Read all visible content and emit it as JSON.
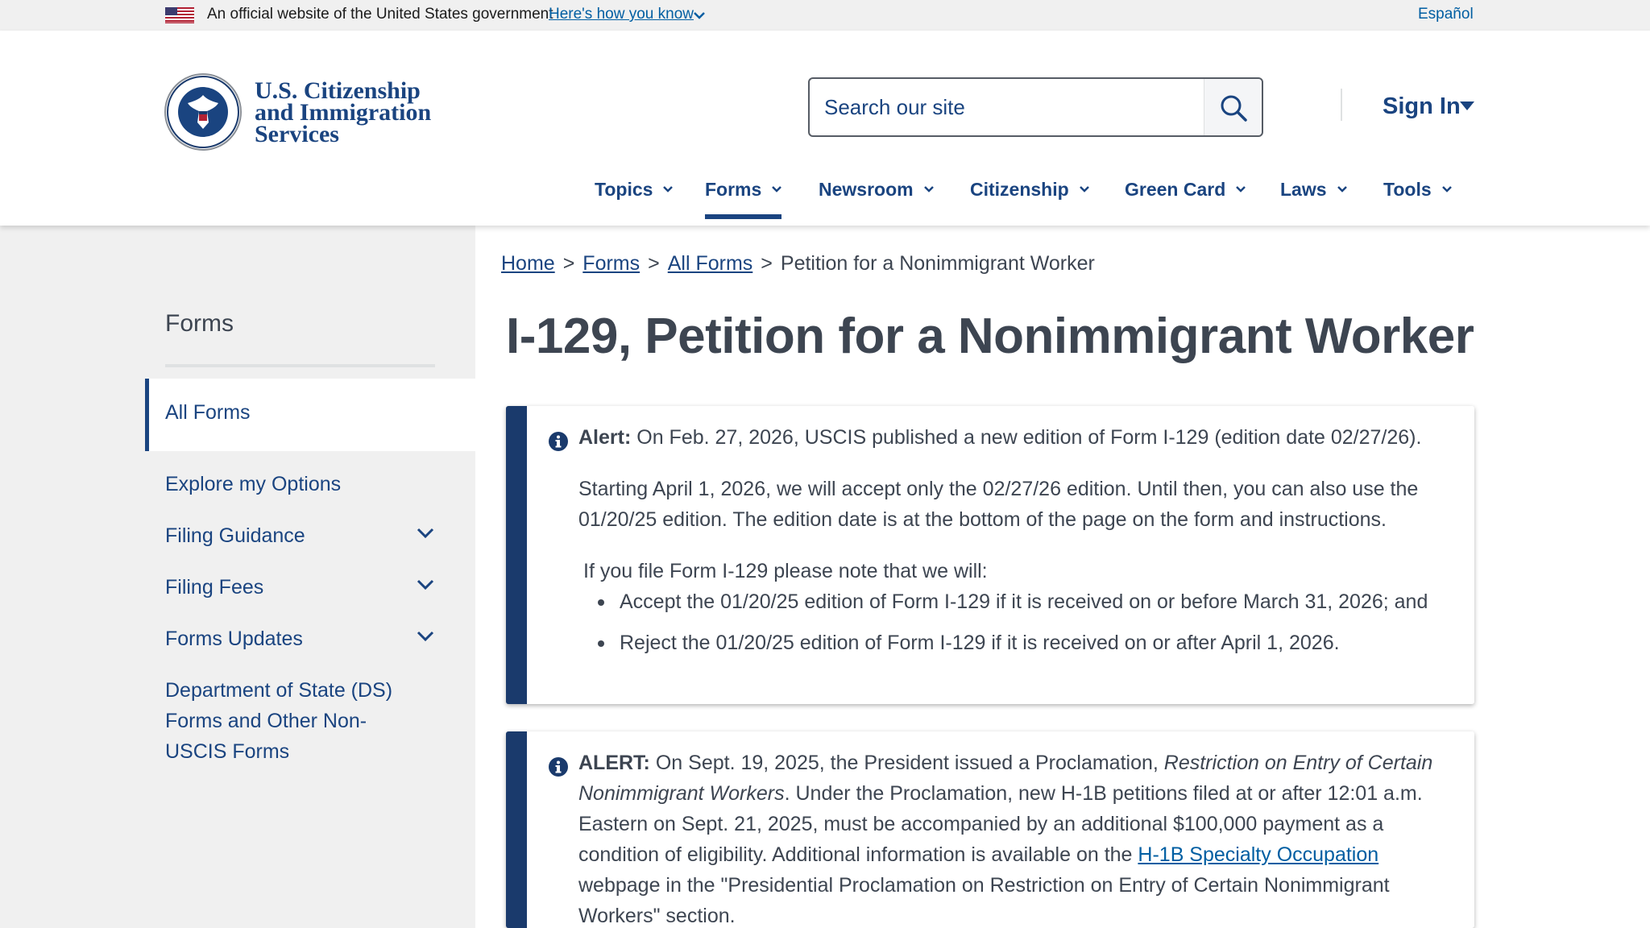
{
  "gov_banner": {
    "text": "An official website of the United States government",
    "how_link": "Here's how you know",
    "language_link": "Español"
  },
  "logo": {
    "line1": "U.S. Citizenship",
    "line2": "and Immigration",
    "line3": "Services"
  },
  "search": {
    "placeholder": "Search our site"
  },
  "sign_in": "Sign In",
  "nav": {
    "items": [
      "Topics",
      "Forms",
      "Newsroom",
      "Citizenship",
      "Green Card",
      "Laws",
      "Tools"
    ],
    "active": "Forms"
  },
  "sidebar": {
    "title": "Forms",
    "active_item": "All Forms",
    "items": [
      {
        "label": "Explore my Options",
        "expandable": false
      },
      {
        "label": "Filing Guidance",
        "expandable": true
      },
      {
        "label": "Filing Fees",
        "expandable": true
      },
      {
        "label": "Forms Updates",
        "expandable": true
      }
    ],
    "multi_item_lines": [
      "Department of State (DS)",
      "Forms and Other Non-",
      "USCIS Forms"
    ]
  },
  "breadcrumb": {
    "home": "Home",
    "forms": "Forms",
    "all_forms": "All Forms",
    "current": "Petition for a Nonimmigrant Worker",
    "separator": ">"
  },
  "page_title": "I-129, Petition for a Nonimmigrant Worker",
  "alert1": {
    "label": "Alert:",
    "line1": "On Feb. 27, 2026, USCIS published a new edition of Form I-129 (edition date 02/27/26).",
    "para2": "Starting April 1, 2026, we will accept only the 02/27/26 edition. Until then, you can also use the 01/20/25 edition. The edition date is at the bottom of the page on the form and instructions.",
    "intro": "If you file Form I-129 please note that we will:",
    "bullets": [
      "Accept the 01/20/25 edition of Form I-129 if it is received on or before March 31, 2026; and",
      "Reject the 01/20/25 edition of Form I-129 if it is received on or after April 1, 2026."
    ]
  },
  "alert2": {
    "label": "ALERT:",
    "text_before": "On Sept. 19, 2025, the President issued a Proclamation, ",
    "italic": "Restriction on Entry of Certain Nonimmigrant Workers",
    "text_mid": ". Under the Proclamation, new H-1B petitions filed at or after 12:01 a.m. Eastern on Sept. 21, 2025, must be accompanied by an additional $100,000 payment as a condition of eligibility. Additional information is available on the ",
    "link": "H-1B Specialty Occupation",
    "text_after": " webpage in the \"Presidential Proclamation on Restriction on Entry of Certain Nonimmigrant Workers\" section."
  },
  "colors": {
    "primary": "#1a4480",
    "link": "#005ea2",
    "alert_border": "#1a3a6c",
    "sidebar_bg": "#f0f0f0",
    "text": "#3d4551"
  }
}
